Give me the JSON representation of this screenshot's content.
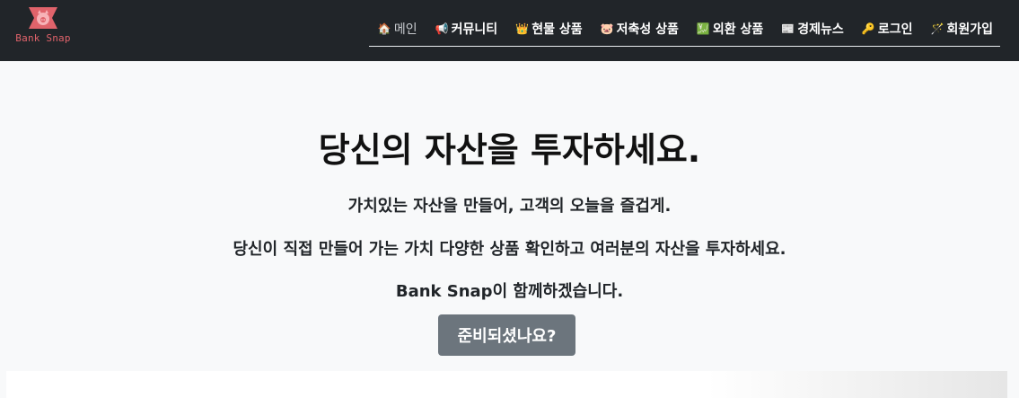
{
  "brand": {
    "name": "Bank Snap",
    "icon": "pig-logo-icon",
    "color": "#e0636b"
  },
  "nav": {
    "items": [
      {
        "label": "메인",
        "icon": "house-icon",
        "glyph": "🏠",
        "active": true
      },
      {
        "label": "커뮤니티",
        "icon": "megaphone-icon",
        "glyph": "📢",
        "active": false
      },
      {
        "label": "현물 상품",
        "icon": "crown-icon",
        "glyph": "👑",
        "active": false
      },
      {
        "label": "저축성 상품",
        "icon": "pig-icon",
        "glyph": "🐷",
        "active": false
      },
      {
        "label": "외환 상품",
        "icon": "chart-up-icon",
        "glyph": "💹",
        "active": false
      },
      {
        "label": "경제뉴스",
        "icon": "newspaper-icon",
        "glyph": "📰",
        "active": false
      },
      {
        "label": "로그인",
        "icon": "key-icon",
        "glyph": "🔑",
        "active": false
      },
      {
        "label": "회원가입",
        "icon": "wand-icon",
        "glyph": "🪄",
        "active": false
      }
    ]
  },
  "hero": {
    "title": "당신의 자산을 투자하세요.",
    "line1": "가치있는 자산을 만들어, 고객의 오늘을 즐겁게.",
    "line2": "당신이 직접 만들어 가는 가치 다양한 상품 확인하고 여러분의 자산을 투자하세요.",
    "line3": "Bank Snap이 함께하겠습니다.",
    "cta_label": "준비되셨나요?"
  },
  "colors": {
    "navbar": "#212529",
    "background": "#f8f9fa",
    "button": "#6c757d"
  }
}
